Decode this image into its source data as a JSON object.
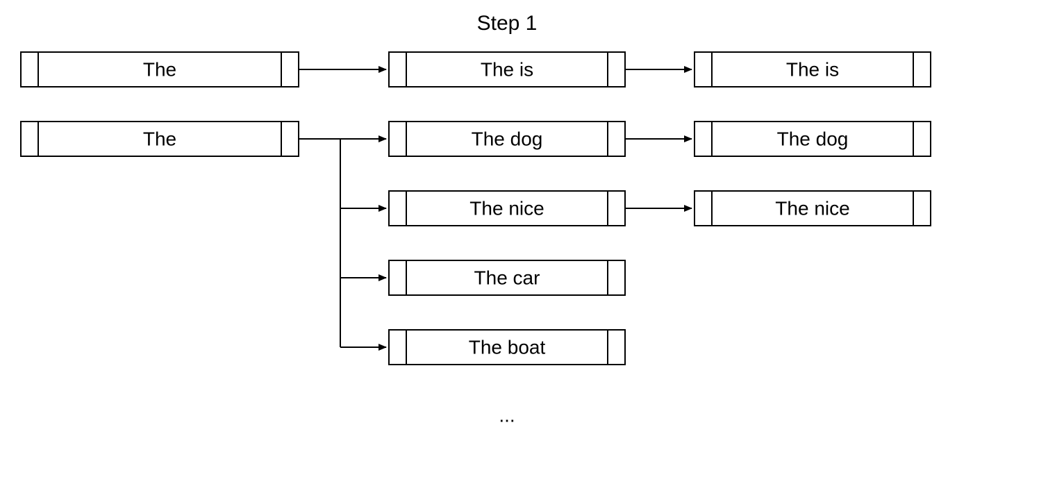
{
  "title": "Step 1",
  "ellipsis": "...",
  "nodes": {
    "col1_row1": "The",
    "col1_row2": "The",
    "col2_row1": "The is",
    "col2_row2": "The dog",
    "col2_row3": "The nice",
    "col2_row4": "The car",
    "col2_row5": "The boat",
    "col3_row1": "The is",
    "col3_row2": "The dog",
    "col3_row3": "The nice"
  }
}
